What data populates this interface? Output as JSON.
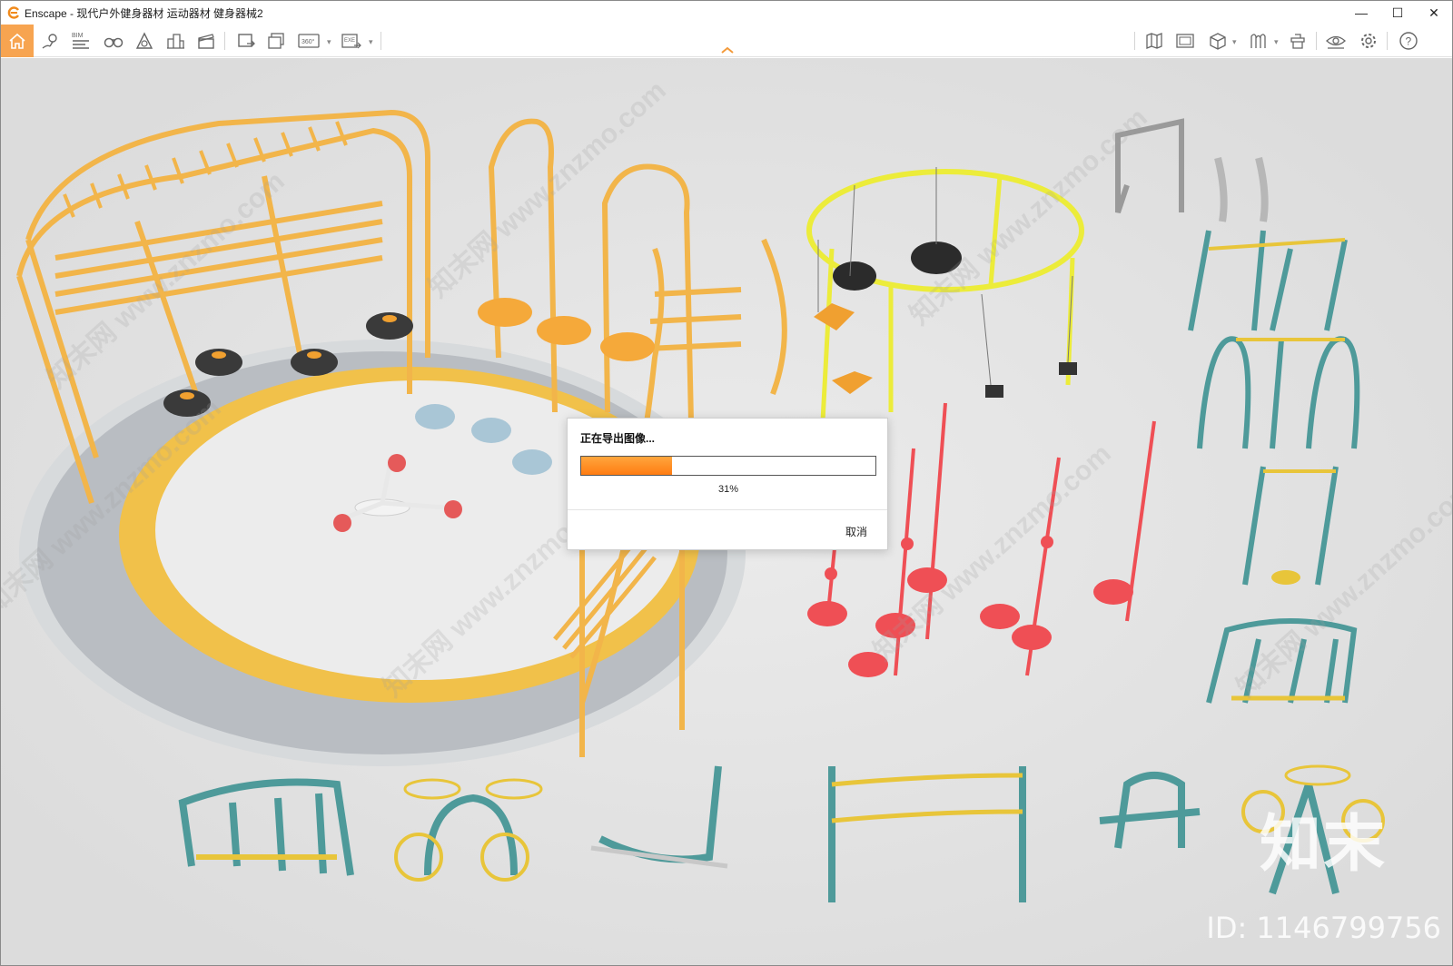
{
  "window": {
    "title": "Enscape - 现代户外健身器材 运动器材 健身器械2",
    "minimize_glyph": "—",
    "maximize_glyph": "☐",
    "close_glyph": "✕"
  },
  "toolbar": {
    "left_icons": [
      "home-icon",
      "location-pin-icon",
      "bim-icon",
      "binoculars-icon",
      "light-view-icon",
      "buildings-icon",
      "clapperboard-icon",
      "screenshot-icon",
      "batch-render-icon",
      "panorama-360-icon",
      "export-exe-icon"
    ],
    "right_icons": [
      "map-icon",
      "image-viewer-icon",
      "cube-icon",
      "asset-library-icon",
      "material-icon",
      "eye-icon",
      "settings-gear-icon",
      "help-icon"
    ],
    "bim_label": "BIM",
    "pano_label": "360°",
    "exe_label": "EXE",
    "active_color": "#f7a450"
  },
  "viewport": {
    "watermark_text": "知末网 www.znzmo.com",
    "logo_text": "知末",
    "id_text": "ID: 1146799756"
  },
  "export_dialog": {
    "title": "正在导出图像...",
    "progress": 0.31,
    "progress_label": "31%",
    "cancel_label": "取消",
    "progress_color": "#ff8a20"
  }
}
